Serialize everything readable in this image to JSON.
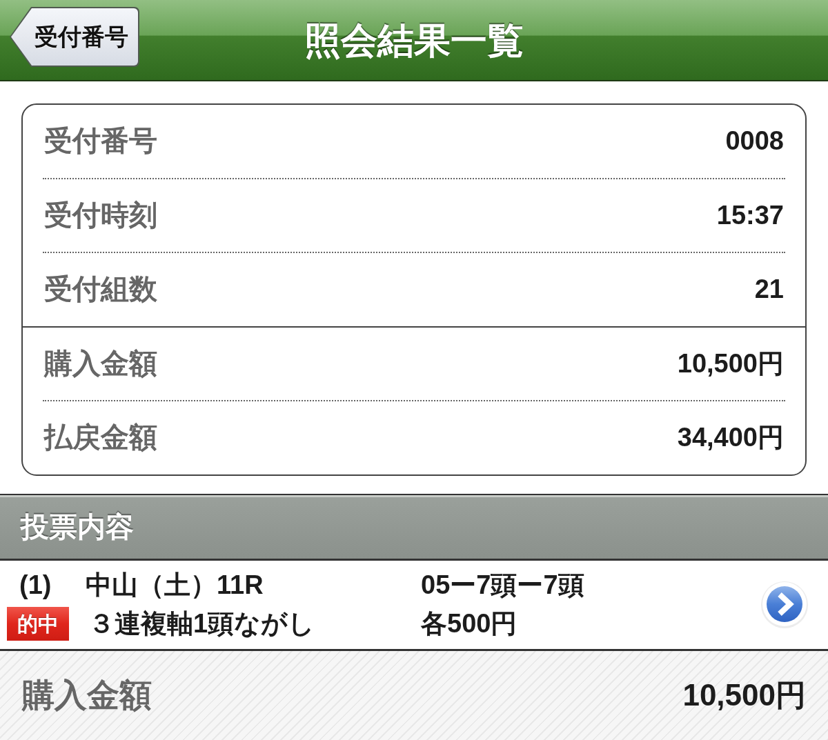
{
  "header": {
    "back_button": "受付番号",
    "title": "照会結果一覧"
  },
  "summary": {
    "groups": [
      {
        "rows": [
          {
            "label": "受付番号",
            "value": "0008"
          },
          {
            "label": "受付時刻",
            "value": "15:37"
          },
          {
            "label": "受付組数",
            "value": "21"
          }
        ]
      },
      {
        "rows": [
          {
            "label": "購入金額",
            "value": "10,500円"
          },
          {
            "label": "払戻金額",
            "value": "34,400円"
          }
        ]
      }
    ]
  },
  "section": {
    "title": "投票内容"
  },
  "bets": [
    {
      "number": "(1)",
      "race": "中山（土）11R",
      "combination": "05ー7頭ー7頭",
      "badge": "的中",
      "bet_type": "３連複軸1頭ながし",
      "amount": "各500円"
    }
  ],
  "footer": {
    "label": "購入金額",
    "value": "10,500円"
  }
}
